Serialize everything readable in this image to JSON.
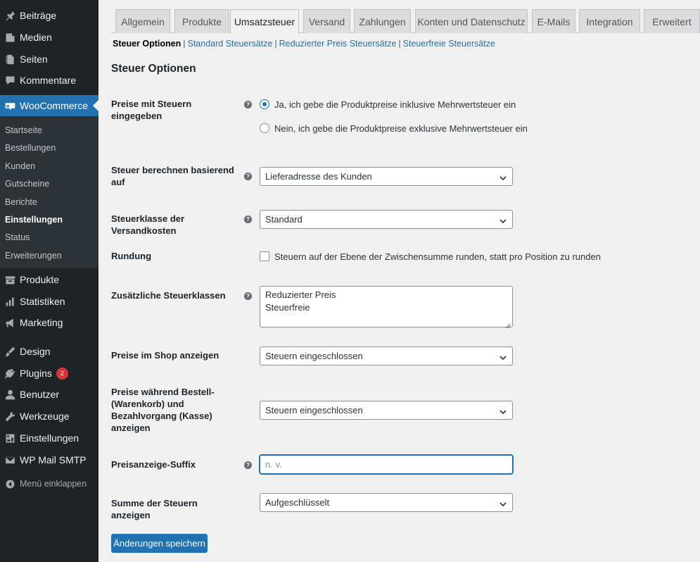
{
  "sidebar": {
    "items": [
      {
        "label": "Beiträge",
        "icon": "pushpin-icon"
      },
      {
        "label": "Medien",
        "icon": "media-icon"
      },
      {
        "label": "Seiten",
        "icon": "pages-icon"
      },
      {
        "label": "Kommentare",
        "icon": "comment-icon"
      },
      {
        "label": "WooCommerce",
        "icon": "woocommerce-icon"
      },
      {
        "label": "Produkte",
        "icon": "archive-icon"
      },
      {
        "label": "Statistiken",
        "icon": "bar-chart-icon"
      },
      {
        "label": "Marketing",
        "icon": "megaphone-icon"
      },
      {
        "label": "Design",
        "icon": "paintbrush-icon"
      },
      {
        "label": "Plugins",
        "icon": "plugin-icon",
        "badge": "2"
      },
      {
        "label": "Benutzer",
        "icon": "user-icon"
      },
      {
        "label": "Werkzeuge",
        "icon": "wrench-icon"
      },
      {
        "label": "Einstellungen",
        "icon": "settings-icon"
      },
      {
        "label": "WP Mail SMTP",
        "icon": "mail-icon"
      }
    ],
    "submenu": [
      "Startseite",
      "Bestellungen",
      "Kunden",
      "Gutscheine",
      "Berichte",
      "Einstellungen",
      "Status",
      "Erweiterungen"
    ],
    "collapse_label": "Menü einklappen"
  },
  "tabs": [
    "Allgemein",
    "Produkte",
    "Umsatzsteuer",
    "Versand",
    "Zahlungen",
    "Konten und Datenschutz",
    "E-Mails",
    "Integration",
    "Erweitert"
  ],
  "subnav": {
    "current": "Steuer Optionen",
    "links": [
      "Standard Steuersätze",
      "Reduzierter Preis Steuersätze",
      "Steuerfreie Steuersätze"
    ]
  },
  "section_title": "Steuer Optionen",
  "fields": {
    "prices_entered": {
      "label": "Preise mit Steuern eingegeben",
      "options": [
        "Ja, ich gebe die Produktpreise inklusive Mehrwertsteuer ein",
        "Nein, ich gebe die Produktpreise exklusive Mehrwertsteuer ein"
      ],
      "selected": 0
    },
    "tax_based_on": {
      "label": "Steuer berechnen basierend auf",
      "value": "Lieferadresse des Kunden"
    },
    "shipping_tax_class": {
      "label": "Steuerklasse der Versandkosten",
      "value": "Standard"
    },
    "rounding": {
      "label": "Rundung",
      "checkbox_label": "Steuern auf der Ebene der Zwischensumme runden, statt pro Position zu runden",
      "checked": false
    },
    "additional_classes": {
      "label": "Zusätzliche Steuerklassen",
      "lines": [
        "Reduzierter Preis",
        "Steuerfreie"
      ]
    },
    "shop_display": {
      "label": "Preise im Shop anzeigen",
      "value": "Steuern eingeschlossen"
    },
    "cart_display": {
      "label": "Preise während Bestell-(Warenkorb) und Bezahlvorgang (Kasse) anzeigen",
      "value": "Steuern eingeschlossen"
    },
    "price_suffix": {
      "label": "Preisanzeige-Suffix",
      "placeholder": "n. v."
    },
    "tax_total_display": {
      "label": "Summe der Steuern anzeigen",
      "value": "Aufgeschlüsselt"
    }
  },
  "save_label": "Änderungen speichern",
  "colors": {
    "accent": "#2271b1",
    "sidebar": "#1d2327",
    "badge": "#d63638"
  }
}
